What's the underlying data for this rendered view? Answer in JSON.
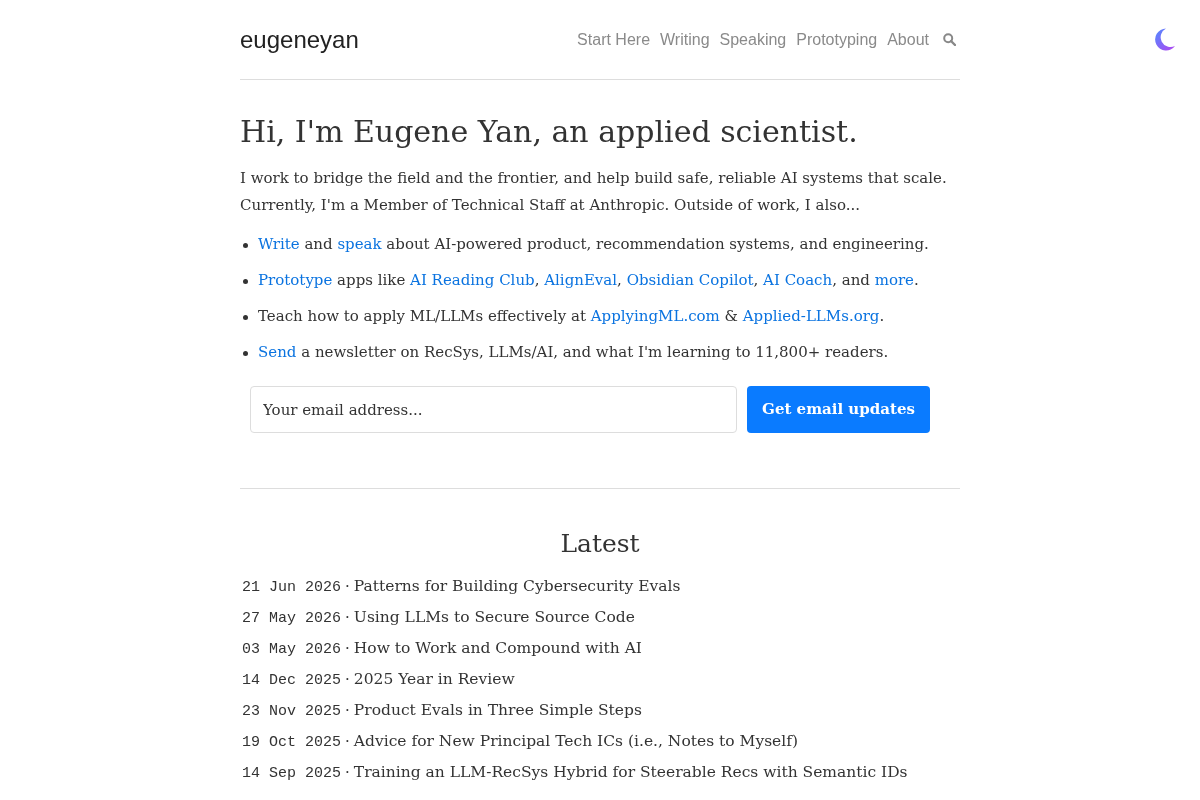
{
  "header": {
    "logo": "eugeneyan",
    "nav": [
      {
        "label": "Start Here"
      },
      {
        "label": "Writing"
      },
      {
        "label": "Speaking"
      },
      {
        "label": "Prototyping"
      },
      {
        "label": "About"
      }
    ]
  },
  "intro": {
    "heading": "Hi, I'm Eugene Yan, an applied scientist.",
    "paragraph": "I work to bridge the field and the frontier, and help build safe, reliable AI systems that scale. Currently, I'm a Member of Technical Staff at Anthropic. Outside of work, I also...",
    "list": [
      {
        "parts": [
          {
            "kind": "link",
            "text": "Write"
          },
          {
            "kind": "plain",
            "text": " and "
          },
          {
            "kind": "link",
            "text": "speak"
          },
          {
            "kind": "plain",
            "text": " about AI-powered product, recommendation systems, and engineering."
          }
        ]
      },
      {
        "parts": [
          {
            "kind": "link",
            "text": "Prototype"
          },
          {
            "kind": "plain",
            "text": " apps like "
          },
          {
            "kind": "link",
            "text": "AI Reading Club"
          },
          {
            "kind": "plain",
            "text": ", "
          },
          {
            "kind": "link",
            "text": "AlignEval"
          },
          {
            "kind": "plain",
            "text": ", "
          },
          {
            "kind": "link",
            "text": "Obsidian Copilot"
          },
          {
            "kind": "plain",
            "text": ", "
          },
          {
            "kind": "link",
            "text": "AI Coach"
          },
          {
            "kind": "plain",
            "text": ", and "
          },
          {
            "kind": "link",
            "text": "more"
          },
          {
            "kind": "plain",
            "text": "."
          }
        ]
      },
      {
        "parts": [
          {
            "kind": "plain",
            "text": "Teach how to apply ML/LLMs effectively at "
          },
          {
            "kind": "link",
            "text": "ApplyingML.com"
          },
          {
            "kind": "plain",
            "text": " & "
          },
          {
            "kind": "link",
            "text": "Applied-LLMs.org"
          },
          {
            "kind": "plain",
            "text": "."
          }
        ]
      },
      {
        "parts": [
          {
            "kind": "link",
            "text": "Send"
          },
          {
            "kind": "plain",
            "text": " a newsletter on RecSys, LLMs/AI, and what I'm learning to 11,800+ readers."
          }
        ]
      }
    ]
  },
  "subscribe": {
    "placeholder": "Your email address...",
    "button": "Get email updates"
  },
  "latest": {
    "title": "Latest",
    "posts": [
      {
        "date": "21 Jun 2026",
        "separator": "·",
        "title": "Patterns for Building Cybersecurity Evals"
      },
      {
        "date": "27 May 2026",
        "separator": "·",
        "title": "Using LLMs to Secure Source Code"
      },
      {
        "date": "03 May 2026",
        "separator": "·",
        "title": "How to Work and Compound with AI"
      },
      {
        "date": "14 Dec 2025",
        "separator": "·",
        "title": "2025 Year in Review"
      },
      {
        "date": "23 Nov 2025",
        "separator": "·",
        "title": "Product Evals in Three Simple Steps"
      },
      {
        "date": "19 Oct 2025",
        "separator": "·",
        "title": "Advice for New Principal Tech ICs (i.e., Notes to Myself)"
      },
      {
        "date": "14 Sep 2025",
        "separator": "·",
        "title": "Training an LLM-RecSys Hybrid for Steerable Recs with Semantic IDs"
      }
    ]
  }
}
